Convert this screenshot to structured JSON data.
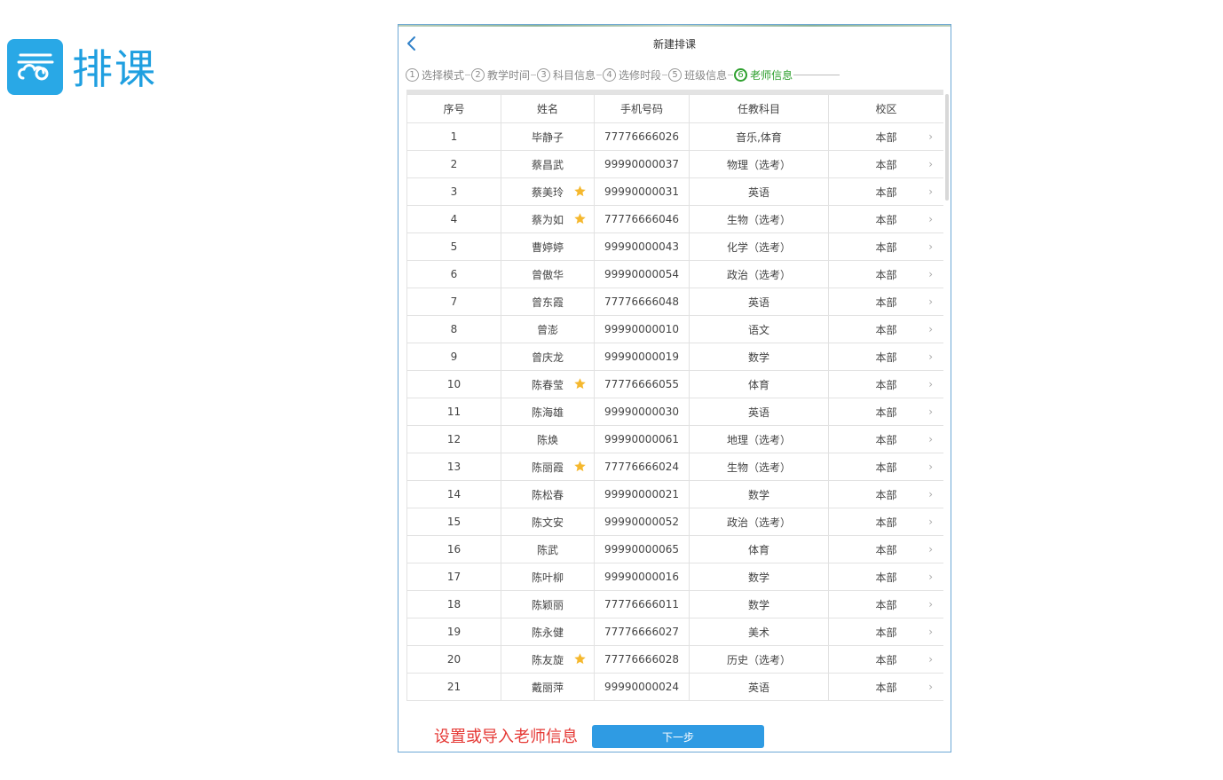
{
  "brand": {
    "text": "排课"
  },
  "header": {
    "title": "新建排课"
  },
  "steps": [
    {
      "num": "1",
      "label": "选择模式",
      "active": false
    },
    {
      "num": "2",
      "label": "教学时间",
      "active": false
    },
    {
      "num": "3",
      "label": "科目信息",
      "active": false
    },
    {
      "num": "4",
      "label": "选修时段",
      "active": false
    },
    {
      "num": "5",
      "label": "班级信息",
      "active": false
    },
    {
      "num": "6",
      "label": "老师信息",
      "active": true
    }
  ],
  "table": {
    "headers": [
      "序号",
      "姓名",
      "手机号码",
      "任教科目",
      "校区"
    ],
    "rows": [
      {
        "no": "1",
        "name": "毕静子",
        "star": false,
        "phone": "77776666026",
        "subject": "音乐,体育",
        "campus": "本部"
      },
      {
        "no": "2",
        "name": "蔡昌武",
        "star": false,
        "phone": "99990000037",
        "subject": "物理（选考）",
        "campus": "本部"
      },
      {
        "no": "3",
        "name": "蔡美玲",
        "star": true,
        "phone": "99990000031",
        "subject": "英语",
        "campus": "本部"
      },
      {
        "no": "4",
        "name": "蔡为如",
        "star": true,
        "phone": "77776666046",
        "subject": "生物（选考）",
        "campus": "本部"
      },
      {
        "no": "5",
        "name": "曹婷婷",
        "star": false,
        "phone": "99990000043",
        "subject": "化学（选考）",
        "campus": "本部"
      },
      {
        "no": "6",
        "name": "曾傲华",
        "star": false,
        "phone": "99990000054",
        "subject": "政治（选考）",
        "campus": "本部"
      },
      {
        "no": "7",
        "name": "曾东霞",
        "star": false,
        "phone": "77776666048",
        "subject": "英语",
        "campus": "本部"
      },
      {
        "no": "8",
        "name": "曾澎",
        "star": false,
        "phone": "99990000010",
        "subject": "语文",
        "campus": "本部"
      },
      {
        "no": "9",
        "name": "曾庆龙",
        "star": false,
        "phone": "99990000019",
        "subject": "数学",
        "campus": "本部"
      },
      {
        "no": "10",
        "name": "陈春莹",
        "star": true,
        "phone": "77776666055",
        "subject": "体育",
        "campus": "本部"
      },
      {
        "no": "11",
        "name": "陈海雄",
        "star": false,
        "phone": "99990000030",
        "subject": "英语",
        "campus": "本部"
      },
      {
        "no": "12",
        "name": "陈焕",
        "star": false,
        "phone": "99990000061",
        "subject": "地理（选考）",
        "campus": "本部"
      },
      {
        "no": "13",
        "name": "陈丽霞",
        "star": true,
        "phone": "77776666024",
        "subject": "生物（选考）",
        "campus": "本部"
      },
      {
        "no": "14",
        "name": "陈松春",
        "star": false,
        "phone": "99990000021",
        "subject": "数学",
        "campus": "本部"
      },
      {
        "no": "15",
        "name": "陈文安",
        "star": false,
        "phone": "99990000052",
        "subject": "政治（选考）",
        "campus": "本部"
      },
      {
        "no": "16",
        "name": "陈武",
        "star": false,
        "phone": "99990000065",
        "subject": "体育",
        "campus": "本部"
      },
      {
        "no": "17",
        "name": "陈叶柳",
        "star": false,
        "phone": "99990000016",
        "subject": "数学",
        "campus": "本部"
      },
      {
        "no": "18",
        "name": "陈颖丽",
        "star": false,
        "phone": "77776666011",
        "subject": "数学",
        "campus": "本部"
      },
      {
        "no": "19",
        "name": "陈永健",
        "star": false,
        "phone": "77776666027",
        "subject": "美术",
        "campus": "本部"
      },
      {
        "no": "20",
        "name": "陈友旋",
        "star": true,
        "phone": "77776666028",
        "subject": "历史（选考）",
        "campus": "本部"
      },
      {
        "no": "21",
        "name": "戴丽萍",
        "star": false,
        "phone": "99990000024",
        "subject": "英语",
        "campus": "本部"
      }
    ]
  },
  "footer": {
    "note": "设置或导入老师信息",
    "next_label": "下一步"
  },
  "colors": {
    "brand": "#29a8e6",
    "active_step": "#2ea02e",
    "star": "#f5b82e",
    "note": "#e53935",
    "button": "#2f9be3"
  },
  "icons": {
    "logo": "cloud-logo-icon",
    "back": "chevron-left-icon",
    "star": "star-icon",
    "row_arrow": "chevron-right-icon"
  }
}
